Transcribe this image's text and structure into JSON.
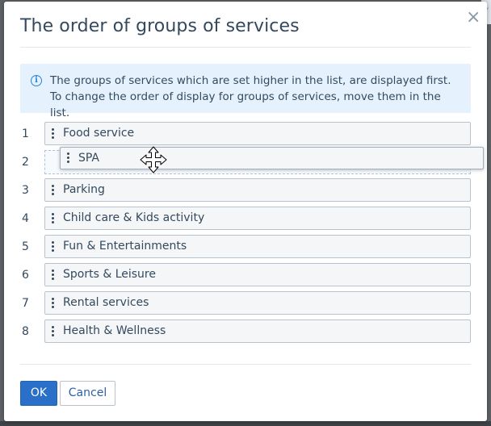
{
  "dialog": {
    "title": "The order of groups of services",
    "close_icon": "×",
    "info_text": "The groups of services which are set higher in the list, are displayed first. To change the order of display for groups of services, move them in the list."
  },
  "list": {
    "numbers": [
      "1",
      "2",
      "3",
      "4",
      "5",
      "6",
      "7",
      "8"
    ],
    "items": [
      "Food service",
      "Parking",
      "Child care & Kids activity",
      "Fun & Entertainments",
      "Sports & Leisure",
      "Rental services",
      "Health & Wellness"
    ],
    "dragging_item": "SPA"
  },
  "buttons": {
    "ok": "OK",
    "cancel": "Cancel"
  },
  "colors": {
    "accent": "#2a70c8",
    "info_bg": "#e5f2fd",
    "text": "#34495e"
  }
}
